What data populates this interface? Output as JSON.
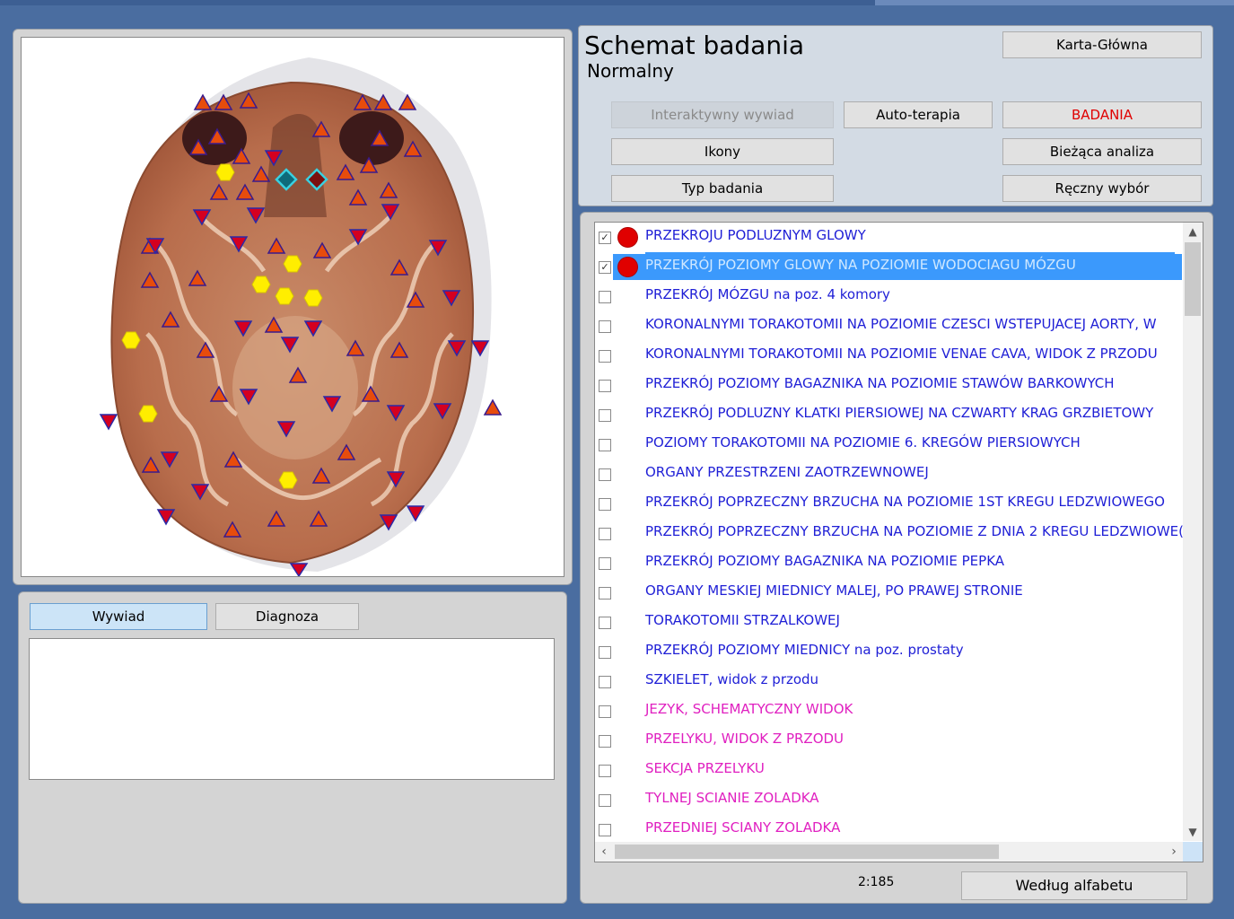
{
  "schema": {
    "title": "Schemat badania",
    "subtitle": "Normalny"
  },
  "buttons": {
    "karta": "Karta-Główna",
    "interaktywny": "Interaktywny wywiad",
    "autoterapia": "Auto-terapia",
    "badania": "BADANIA",
    "ikony": "Ikony",
    "biezaca": "Bieżąca analiza",
    "typ": "Typ badania",
    "reczny": "Ręczny wybór",
    "sort": "Według alfabetu"
  },
  "tabs": {
    "wywiad": "Wywiad",
    "diagnoza": "Diagnoza"
  },
  "list": {
    "count": "2:185",
    "items": [
      {
        "label": "PRZEKROJU PODLUZNYM GLOWY",
        "checked": true,
        "marker": true
      },
      {
        "label": "PRZEKRÓJ POZIOMY GLOWY NA POZIOMIE WODOCIAGU MÓZGU",
        "checked": true,
        "marker": true,
        "selected": true
      },
      {
        "label": "PRZEKRÓJ MÓZGU na poz. 4 komory"
      },
      {
        "label": "KORONALNYMI TORAKOTOMII NA POZIOMIE CZESCI WSTEPUJACEJ AORTY, W"
      },
      {
        "label": "KORONALNYMI TORAKOTOMII NA POZIOMIE VENAE CAVA, WIDOK Z PRZODU"
      },
      {
        "label": "PRZEKRÓJ POZIOMY BAGAZNIKA NA POZIOMIE STAWÓW BARKOWYCH"
      },
      {
        "label": "PRZEKRÓJ PODLUZNY KLATKI PIERSIOWEJ NA CZWARTY KRAG GRZBIETOWY"
      },
      {
        "label": "POZIOMY TORAKOTOMII NA POZIOMIE 6. KREGÓW PIERSIOWYCH"
      },
      {
        "label": "ORGANY PRZESTRZENI ZAOTRZEWNOWEJ"
      },
      {
        "label": "PRZEKRÓJ POPRZECZNY BRZUCHA NA POZIOMIE 1ST KREGU LEDZWIOWEGO"
      },
      {
        "label": "PRZEKRÓJ POPRZECZNY BRZUCHA NA POZIOMIE Z DNIA 2 KREGU LEDZWIOWE("
      },
      {
        "label": "PRZEKRÓJ POZIOMY BAGAZNIKA NA POZIOMIE PEPKA"
      },
      {
        "label": "ORGANY MESKIEJ MIEDNICY MALEJ, PO PRAWEJ STRONIE"
      },
      {
        "label": "TORAKOTOMII STRZALKOWEJ"
      },
      {
        "label": "PRZEKRÓJ POZIOMY MIEDNICY na poz. prostaty"
      },
      {
        "label": "SZKIELET, widok z przodu"
      },
      {
        "label": "JEZYK, SCHEMATYCZNY WIDOK",
        "magenta": true
      },
      {
        "label": "PRZELYKU, WIDOK Z PRZODU",
        "magenta": true
      },
      {
        "label": "SEKCJA PRZELYKU",
        "magenta": true
      },
      {
        "label": "TYLNEJ SCIANIE ZOLADKA",
        "magenta": true
      },
      {
        "label": "PRZEDNIEJ SCIANY ZOLADKA",
        "magenta": true
      }
    ]
  },
  "colors": {
    "link": "#1f1fd6",
    "magenta": "#e020c0",
    "marker": "#e00000",
    "selection": "#3b99fc"
  },
  "icons": {
    "checkbox": "check-mark",
    "marker": "red-dot",
    "scroll_up": "chevron-up",
    "scroll_down": "chevron-down",
    "scroll_left": "chevron-left",
    "scroll_right": "chevron-right"
  }
}
